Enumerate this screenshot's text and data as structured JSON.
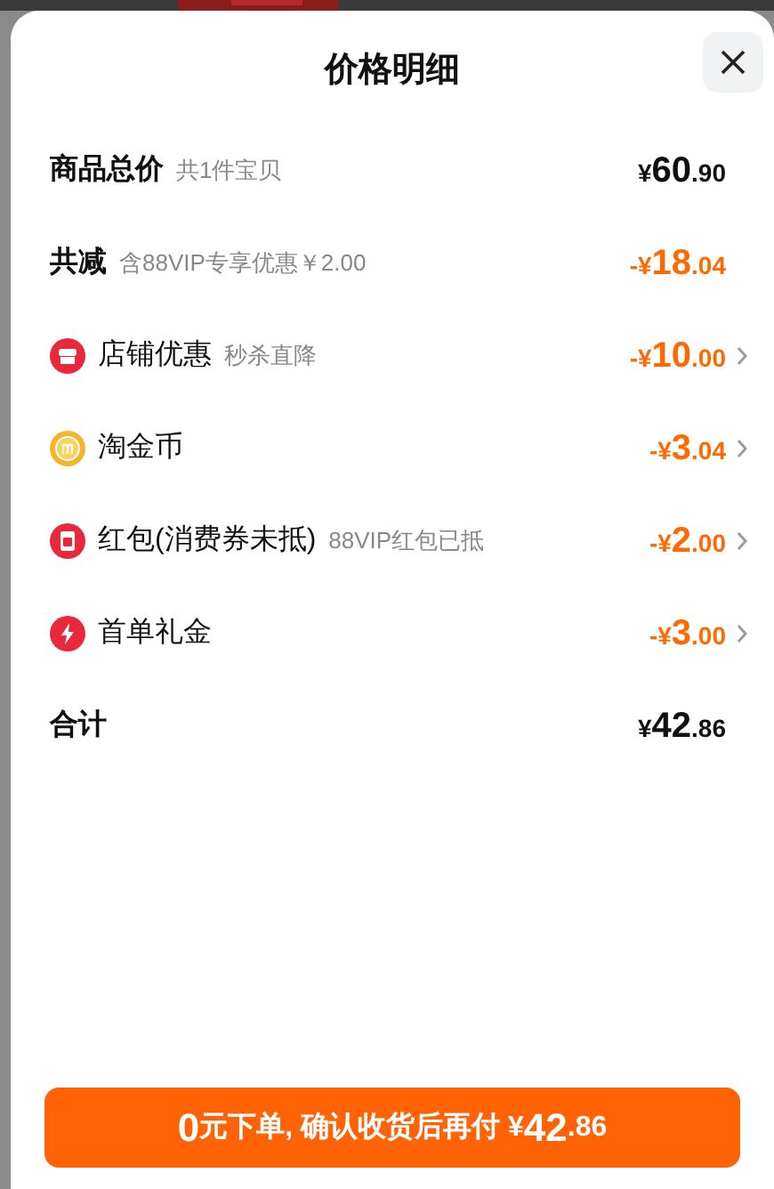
{
  "title": "价格明细",
  "rows": [
    {
      "kind": "plain",
      "label": "商品总价",
      "note": "共1件宝贝",
      "amount": "¥60.90"
    },
    {
      "kind": "discount",
      "label": "共减",
      "note": "含88VIP专享优惠￥2.00",
      "amount": "-¥18.04"
    },
    {
      "kind": "item",
      "label": "店铺优惠",
      "note": "秒杀直降",
      "amount": "-¥10.00",
      "chevron": true
    },
    {
      "kind": "item",
      "label": "淘金币",
      "amount": "-¥3.04",
      "chevron": true
    },
    {
      "kind": "item",
      "label": "红包(消费券未抵)",
      "note": "88VIP红包已抵",
      "amount": "-¥2.00",
      "chevron": true
    },
    {
      "kind": "item",
      "label": "首单礼金",
      "amount": "-¥3.00",
      "chevron": true
    },
    {
      "kind": "plain",
      "label": "合计",
      "amount": "¥42.86"
    }
  ],
  "button": {
    "label": "0元下单, 确认收货后再付 ¥42.86"
  }
}
